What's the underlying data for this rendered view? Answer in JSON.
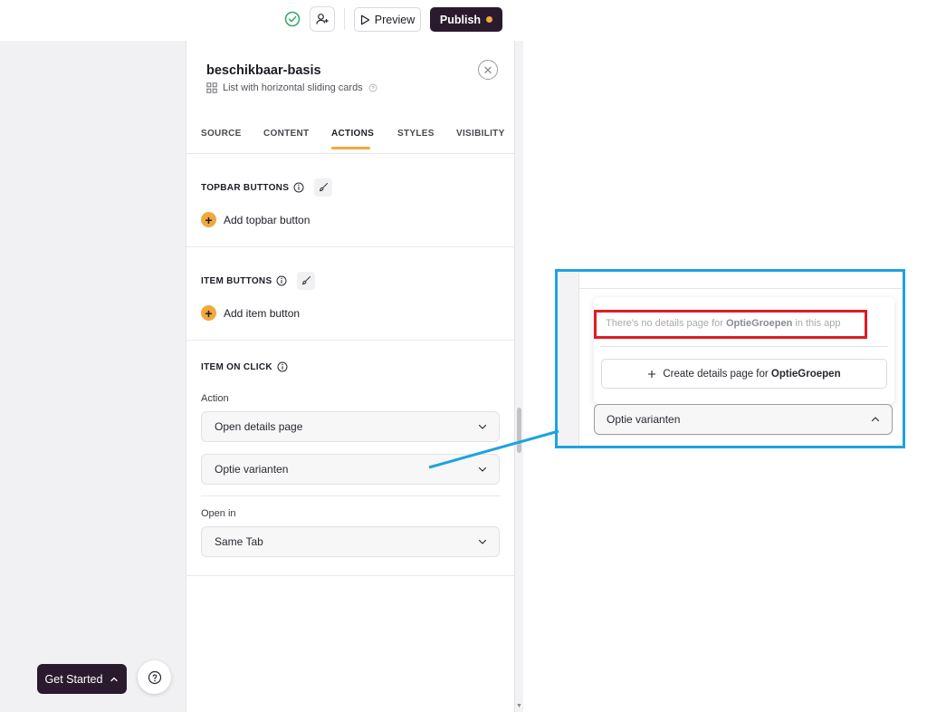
{
  "toolbar": {
    "preview_label": "Preview",
    "publish_label": "Publish"
  },
  "component": {
    "title": "beschikbaar-basis",
    "subtitle": "List with horizontal sliding cards"
  },
  "tabs": [
    {
      "label": "SOURCE"
    },
    {
      "label": "CONTENT"
    },
    {
      "label": "ACTIONS"
    },
    {
      "label": "STYLES"
    },
    {
      "label": "VISIBILITY"
    }
  ],
  "topbar_buttons": {
    "heading": "TOPBAR BUTTONS",
    "add_label": "Add topbar button"
  },
  "item_buttons": {
    "heading": "ITEM BUTTONS",
    "add_label": "Add item button"
  },
  "item_on_click": {
    "heading": "ITEM ON CLICK",
    "action_label": "Action",
    "action_value": "Open details page",
    "target_value": "Optie varianten",
    "open_in_label": "Open in",
    "open_in_value": "Same Tab"
  },
  "bottom": {
    "get_started_label": "Get Started"
  },
  "zoom": {
    "msg_prefix": "There's no details page for ",
    "msg_entity": "OptieGroepen",
    "msg_suffix": " in this app",
    "create_prefix": "Create details page for ",
    "create_entity": "OptieGroepen",
    "select_value": "Optie varianten"
  },
  "colors": {
    "accent": "#f1a93b",
    "primary_dark": "#2a1a2e",
    "callout_blue": "#1ea3e0",
    "highlight_red": "#e01b25"
  }
}
